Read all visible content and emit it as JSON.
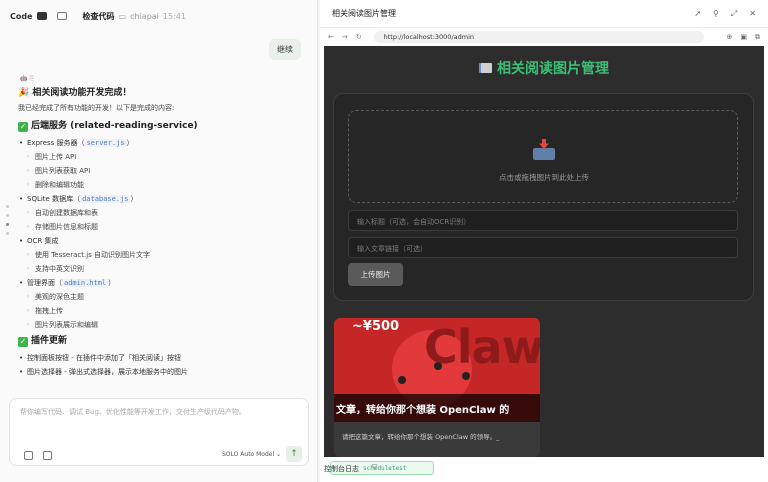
{
  "left_panel": {
    "toolbar": {
      "code_label": "Code",
      "project": "检查代码",
      "folder": "chiapai",
      "time": "15:41"
    },
    "user_bubble": "继续",
    "assistant_meta": "🤖 ⎘",
    "message": {
      "title": "🎉 相关阅读功能开发完成！",
      "intro": "我已经完成了所有功能的开发！以下是完成的内容:",
      "section1": "后端服务 (related-reading-service)",
      "s1_item1_prefix": "Express 服务器（",
      "s1_item1_code": "server.js",
      "s1_item1_suffix": "）",
      "s1_item1_subs": [
        "图片上传 API",
        "图片列表获取 API",
        "删除和编辑功能"
      ],
      "s1_item2_prefix": "SQLite 数据库（",
      "s1_item2_code": "database.js",
      "s1_item2_suffix": "）",
      "s1_item2_subs": [
        "自动创建数据库和表",
        "存储图片信息和标题"
      ],
      "s1_item3": "OCR 集成",
      "s1_item3_subs": [
        "使用 Tesseract.js 自动识别图片文字",
        "支持中英文识别"
      ],
      "s1_item4_prefix": "管理界面（",
      "s1_item4_code": "admin.html",
      "s1_item4_suffix": "）",
      "s1_item4_subs": [
        "美观的深色主题",
        "拖拽上传",
        "图片列表展示和编辑"
      ],
      "section2": "插件更新",
      "s2_item1": "控制面板按钮 - 在插件中添加了「相关阅读」按钮",
      "s2_item2": "图片选择器 - 弹出式选择器，展示本地服务中的图片"
    },
    "chat_input": {
      "placeholder": "帮你编写代码、调试 Bug、优化性能等开发工作，交付生产级代码产物。",
      "model": "SOLO Auto Model ⌄",
      "send": "↑"
    }
  },
  "right_panel": {
    "title": "相关阅读图片管理",
    "url": "http://localhost:3000/admin",
    "page": {
      "heading": "相关阅读图片管理",
      "drop_text": "点击或拖拽图片到此处上传",
      "title_placeholder": "输入标题（可选，会自动OCR识别）",
      "link_placeholder": "输入文章链接（可选）",
      "upload_button": "上传图片",
      "tile": {
        "price": "~¥500",
        "claw_text": "Claw",
        "headline": "文章，转给你那个想装 OpenClaw 的",
        "desc": "请把这篇文章，转给你那个想装 OpenClaw 的领导。_"
      }
    },
    "console": {
      "label": "控制台日志",
      "chip": "scheduletest"
    }
  },
  "colors": {
    "accent_green": "#3bbf74",
    "dark_bg": "#2d2d2d",
    "red_image": "#c52727"
  }
}
